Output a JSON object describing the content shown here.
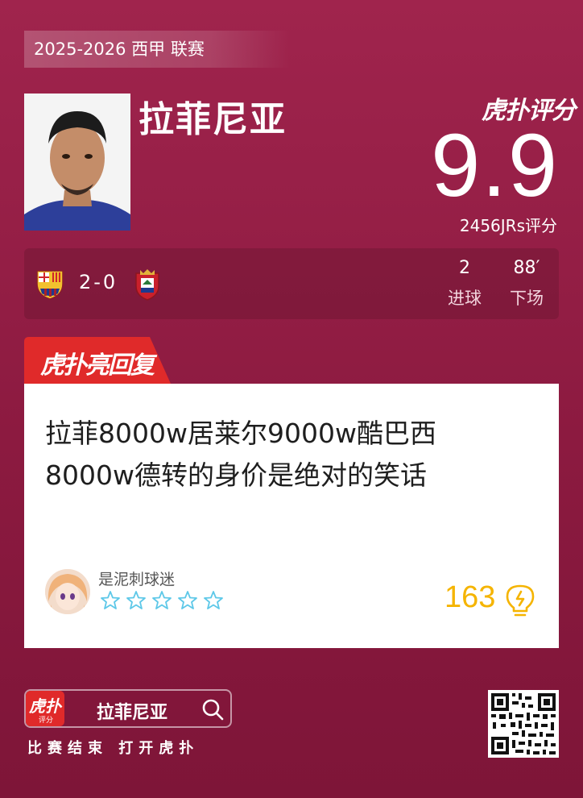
{
  "header": {
    "league": "2025-2026 西甲 联赛"
  },
  "player": {
    "name": "拉菲尼亚"
  },
  "rating": {
    "brand": "虎扑评分",
    "score": "9.9",
    "count": "2456JRs评分"
  },
  "match": {
    "score": "2-0",
    "home_team_icon": "barcelona-crest",
    "away_team_icon": "osasuna-crest",
    "stats": [
      {
        "value": "2",
        "label": "进球"
      },
      {
        "value": "88′",
        "label": "下场"
      }
    ]
  },
  "highlight": {
    "banner": "虎扑亮回复",
    "comment_line1": "拉菲8000w居莱尔9000w酷巴西",
    "comment_line2": "8000w德转的身价是绝对的笑话",
    "username": "是泥刺球迷",
    "stars": 0,
    "likes": "163"
  },
  "footer": {
    "app_logo": "虎扑",
    "app_logo_sub": "评分",
    "search_text": "拉菲尼亚",
    "tagline": "比赛结束 打开虎扑"
  },
  "colors": {
    "accent": "#e02a2a",
    "background": "#961f47",
    "likes": "#f5b400",
    "stars": "#5ec8e8"
  }
}
